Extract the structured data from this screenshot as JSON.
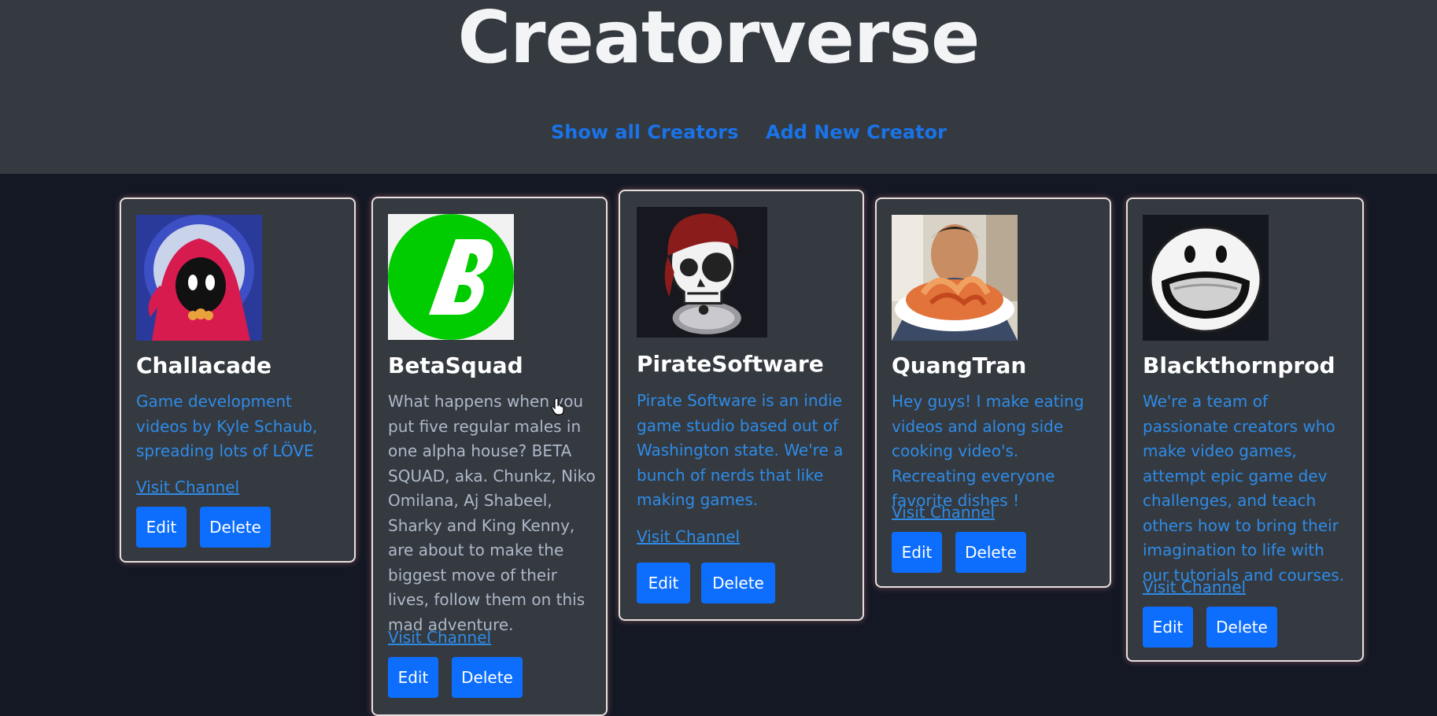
{
  "app": {
    "title": "Creatorverse"
  },
  "nav": {
    "show_all": "Show all Creators",
    "add_new": "Add New Creator"
  },
  "creators": [
    {
      "name": "Challacade",
      "description": "Game development videos by Kyle Schaub, spreading lots of LÖVE",
      "link": "Visit Channel",
      "edit": "Edit",
      "delete": "Delete",
      "avatar_icon": "red-hooded-character-icon",
      "desc_color": "#2f8be8"
    },
    {
      "name": "BetaSquad",
      "description": "What happens when you put five regular males in one alpha house? BETA SQUAD, aka. Chunkz, Niko Omilana, Aj Shabeel, Sharky and King Kenny, are about to make the biggest move of their lives, follow them on this mad adventure.",
      "link": "Visit Channel",
      "edit": "Edit",
      "delete": "Delete",
      "avatar_icon": "green-b-logo-icon",
      "desc_color": "#aeb8c8"
    },
    {
      "name": "PirateSoftware",
      "description": "Pirate Software is an indie game studio based out of Washington state. We're a bunch of nerds that like making games.",
      "link": "Visit Channel",
      "edit": "Edit",
      "delete": "Delete",
      "avatar_icon": "pirate-skull-icon",
      "desc_color": "#2f8be8"
    },
    {
      "name": "QuangTran",
      "description": "Hey guys! I make eating videos and along side cooking video's. Recreating everyone favorite dishes !",
      "link": "Visit Channel",
      "edit": "Edit",
      "delete": "Delete",
      "avatar_icon": "person-eating-noodles-photo",
      "desc_color": "#2f8be8"
    },
    {
      "name": "Blackthornprod",
      "description": "We're a team of passionate creators who make video games, attempt epic game dev challenges, and teach others how to bring their imagination to life with our tutorials and courses.",
      "link": "Visit Channel",
      "edit": "Edit",
      "delete": "Delete",
      "avatar_icon": "smiling-face-logo-icon",
      "desc_color": "#2f8be8"
    }
  ],
  "colors": {
    "header_bg": "#343a40",
    "page_bg": "#141824",
    "link": "#1a73e8",
    "button": "#0d6efd"
  }
}
